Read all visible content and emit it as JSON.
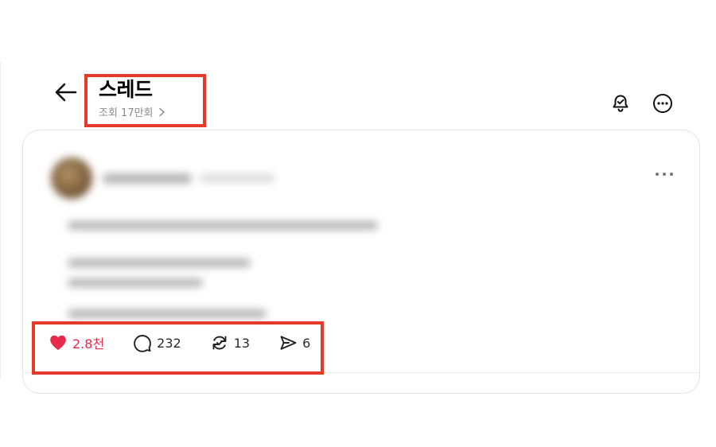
{
  "header": {
    "title": "스레드",
    "views_label": "조회 17만회",
    "icons": {
      "back": "arrow-left-icon",
      "notify": "bell-check-icon",
      "more": "more-circle-icon"
    }
  },
  "post": {
    "author_blurred": true,
    "more_icon": "ellipsis-icon",
    "actions": {
      "like": {
        "icon": "heart-icon",
        "count": "2.8천",
        "color": "#e8294b",
        "liked": true
      },
      "reply": {
        "icon": "comment-icon",
        "count": "232"
      },
      "repost": {
        "icon": "repost-icon",
        "count": "13"
      },
      "share": {
        "icon": "send-icon",
        "count": "6"
      }
    }
  },
  "annotations": {
    "highlight_color": "#e53a2a"
  }
}
